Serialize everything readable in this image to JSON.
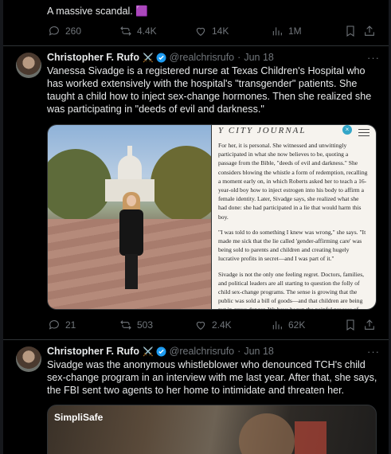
{
  "prev_tweet": {
    "text": "A massive scandal. 🟪",
    "stats": {
      "replies": "260",
      "retweets": "4.4K",
      "likes": "14K",
      "views": "1M"
    }
  },
  "tweet1": {
    "name": "Christopher F. Rufo",
    "badge_emoji": "⚔️",
    "handle": "@realchrisrufo",
    "sep": "·",
    "date": "Jun 18",
    "more": "···",
    "text": "Vanessa Sivadge is a registered nurse at Texas Children's Hospital who has worked extensively with the hospital's \"transgender\" patients. She taught a child how to inject sex-change hormones. Then she realized she was participating in \"deeds of evil and darkness.\"",
    "doc": {
      "brand": "Y CITY JOURNAL",
      "close": "×",
      "paragraphs": [
        "For her, it is personal. She witnessed and unwittingly participated in what she now believes to be, quoting a passage from the Bible, \"deeds of evil and darkness.\" She considers blowing the whistle a form of redemption, recalling a moment early on, in which Roberts asked her to teach a 16-year-old boy how to inject estrogen into his body to affirm a female identity. Later, Sivadge says, she realized what she had done: she had participated in a lie that would harm this boy.",
        "\"I was told to do something I knew was wrong,\" she says. \"It made me sick that the lie called 'gender-affirming care' was being sold to parents and children and creating hugely lucrative profits in secret—and I was part of it.\"",
        "Sivadge is not the only one feeling regret. Doctors, families, and political leaders are all starting to question the folly of child sex-change programs. The sense is growing that the public was sold a bill of goods—and that children are being put in grave danger. We have begun the painful process of recognition. The activist euphoria has worn off, the old rationalizations no longer suffice, and the bill has come due."
      ]
    },
    "stats": {
      "replies": "21",
      "retweets": "503",
      "likes": "2.4K",
      "views": "62K"
    }
  },
  "tweet2": {
    "name": "Christopher F. Rufo",
    "badge_emoji": "⚔️",
    "handle": "@realchrisrufo",
    "sep": "·",
    "date": "Jun 18",
    "more": "···",
    "text": "Sivadge was the anonymous whistleblower who denounced TCH's child sex-change program in an interview with me last year. After that, she says, the FBI sent two agents to her home to intimidate and threaten her.",
    "video_logo": "SimpliSafe"
  },
  "colors": {
    "background": "#000000",
    "text": "#e7e9ea",
    "muted": "#71767b",
    "border": "#2f3336",
    "verified": "#1d9bf0"
  }
}
